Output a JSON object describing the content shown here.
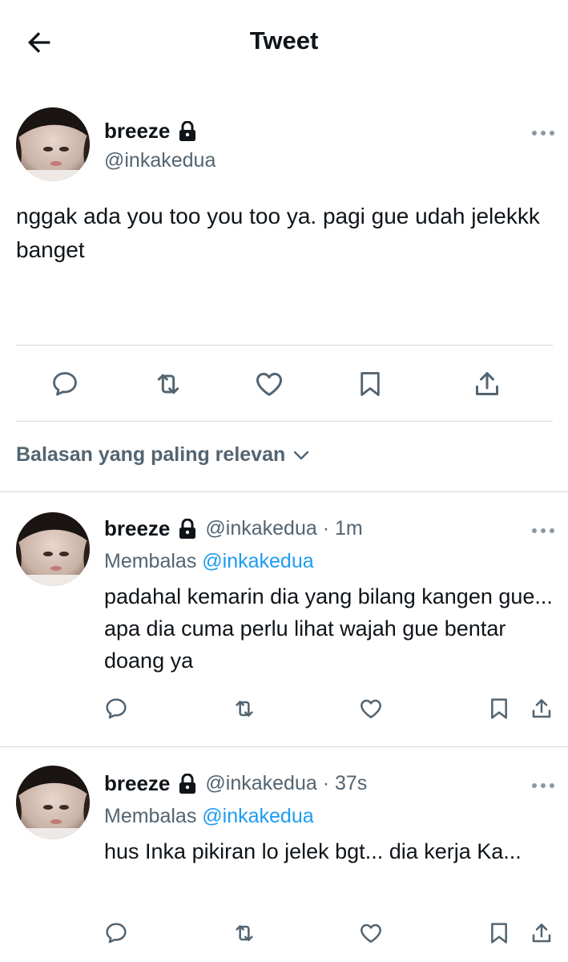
{
  "header": {
    "title": "Tweet",
    "back_icon": "arrow-left-icon"
  },
  "main_tweet": {
    "name": "breeze",
    "handle": "@inkakedua",
    "text": "nggak ada you too you too ya. pagi gue udah jelekkk banget",
    "actions": [
      "reply-icon",
      "retweet-icon",
      "like-icon",
      "bookmark-icon",
      "share-icon"
    ]
  },
  "replies_sort": {
    "label": "Balasan yang paling relevan",
    "icon": "chevron-down-icon"
  },
  "replies": [
    {
      "name": "breeze",
      "meta": "@inkakedua · 1m",
      "replying_prefix": "Membalas",
      "replying_to": "@inkakedua",
      "text": "padahal kemarin dia yang bilang kangen gue... apa dia cuma perlu lihat wajah gue bentar doang ya"
    },
    {
      "name": "breeze",
      "meta": "@inkakedua · 37s",
      "replying_prefix": "Membalas",
      "replying_to": "@inkakedua",
      "text": "hus Inka pikiran lo jelek bgt... dia kerja Ka..."
    }
  ],
  "colors": {
    "text": "#0f1419",
    "secondary": "#536471",
    "accent": "#1d9bf0",
    "divider": "#cfd9de"
  }
}
